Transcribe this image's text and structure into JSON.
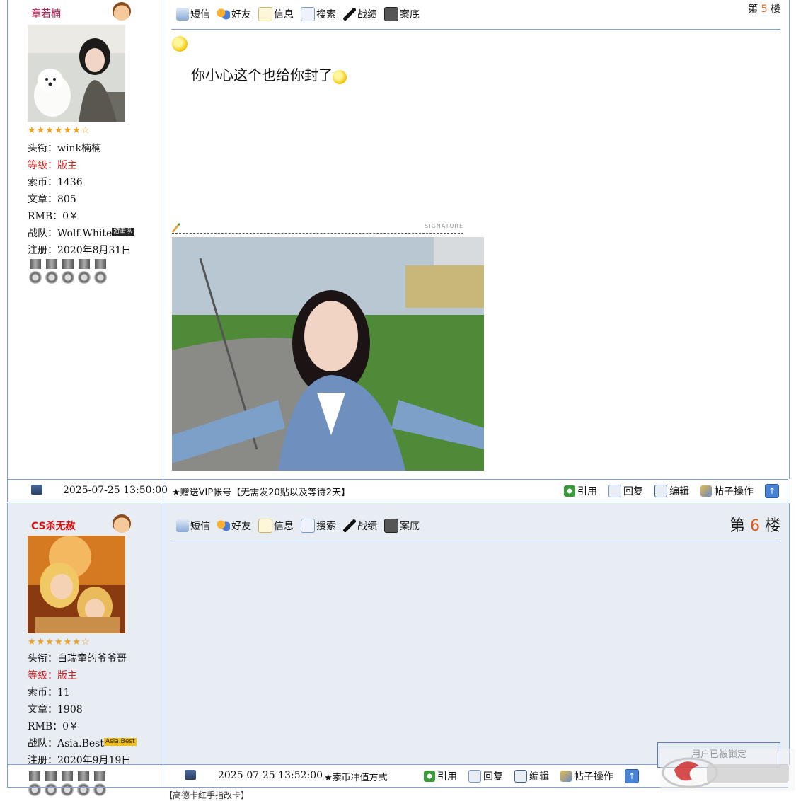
{
  "posts": [
    {
      "username": "章若楠",
      "stars": "★★★★★★☆",
      "title_label": "头衔：",
      "title_value": "wink楠楠",
      "level_label": "等级：",
      "level_value": "版主",
      "coins_label": "索币：",
      "coins_value": "1436",
      "articles_label": "文章：",
      "articles_value": "805",
      "rmb_label": "RMB：",
      "rmb_value": "0￥",
      "team_label": "战队：",
      "team_value": "Wolf.White",
      "team_badge": "游击队",
      "reg_label": "注册：",
      "reg_value": "2020年8月31日",
      "floor_prefix": "第",
      "floor_num": "5",
      "floor_suffix": "楼",
      "message": "你小心这个也给你封了",
      "signature_label": "SIGNATURE",
      "date": "2025-07-25 13:50:00",
      "footer_note": "★赠送VIP帐号【无需发20贴以及等待2天】"
    },
    {
      "username": "CS杀无赦",
      "stars": "★★★★★★☆",
      "title_label": "头衔：",
      "title_value": "白瑞童的爷爷哥",
      "level_label": "等级：",
      "level_value": "版主",
      "coins_label": "索币：",
      "coins_value": "11",
      "articles_label": "文章：",
      "articles_value": "1908",
      "rmb_label": "RMB：",
      "rmb_value": "0￥",
      "team_label": "战队：",
      "team_value": "Asia.Best",
      "team_badge": "Asia.Best",
      "reg_label": "注册：",
      "reg_value": "2020年9月19日",
      "floor_prefix": "第",
      "floor_num": "6",
      "floor_suffix": "楼",
      "date": "2025-07-25 13:52:00",
      "footer_note": "★索币冲值方式"
    }
  ],
  "toolbar": {
    "sms": "短信",
    "friend": "好友",
    "info": "信息",
    "search": "搜索",
    "record": "战绩",
    "case": "案底"
  },
  "actions": {
    "quote": "引用",
    "reply": "回复",
    "edit": "编辑",
    "manage": "帖子操作",
    "top": "↑"
  },
  "locked_text": "用户已被锁定",
  "bottom_text": "【高德卡红手指改卡】",
  "colors": {
    "border": "#7fa1d6",
    "username": "#c0174b",
    "level": "#d12020",
    "floor_num": "#e05a14"
  }
}
